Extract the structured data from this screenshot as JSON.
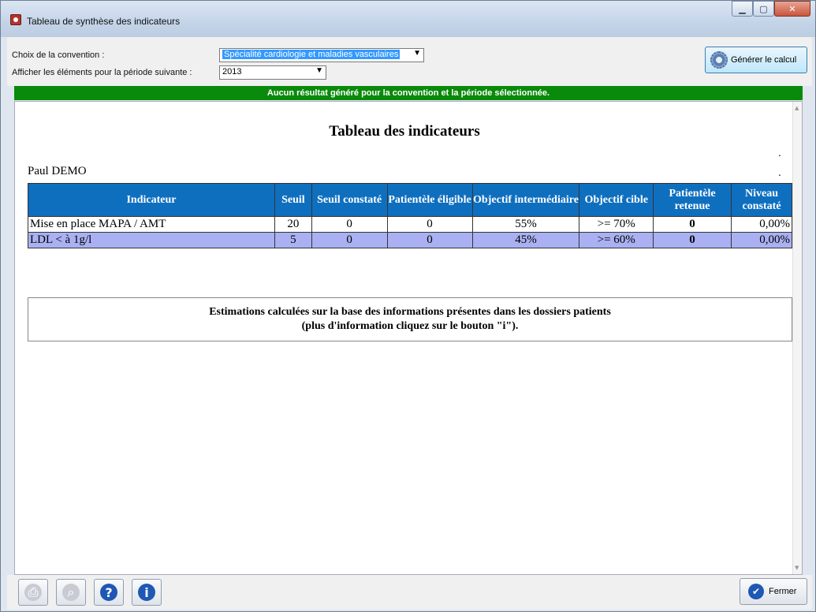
{
  "window": {
    "title": "Tableau de synthèse des indicateurs"
  },
  "toolbar": {
    "convention_label": "Choix de la convention :",
    "convention_value": "Spécialité cardiologie et maladies vasculaires",
    "period_label": "Afficher les éléments pour la période suivante :",
    "period_value": "2013",
    "generate_label": "Générer le calcul"
  },
  "banner": "Aucun résultat généré pour la convention et la période sélectionnée.",
  "report": {
    "title": "Tableau des indicateurs",
    "patient": "Paul DEMO",
    "columns": [
      "Indicateur",
      "Seuil",
      "Seuil constaté",
      "Patientèle éligible",
      "Objectif intermédiaire",
      "Objectif cible",
      "Patientèle retenue",
      "Niveau constaté"
    ],
    "rows": [
      [
        "Mise en place MAPA / AMT",
        "20",
        "0",
        "0",
        "55%",
        ">= 70%",
        "0",
        "0,00%"
      ],
      [
        "LDL < à 1g/l",
        "5",
        "0",
        "0",
        "45%",
        ">= 60%",
        "0",
        "0,00%"
      ]
    ],
    "note_line1": "Estimations calculées sur la base des informations présentes dans les dossiers patients",
    "note_line2": "(plus d'information cliquez sur le bouton \"i\")."
  },
  "footer": {
    "close_label": "Fermer",
    "icons": [
      "print-icon",
      "preview-icon",
      "help-icon",
      "info-icon"
    ]
  },
  "colors": {
    "banner": "#0a8a0a",
    "header": "#0f6fbf",
    "alt_row": "#a9b1f2"
  }
}
